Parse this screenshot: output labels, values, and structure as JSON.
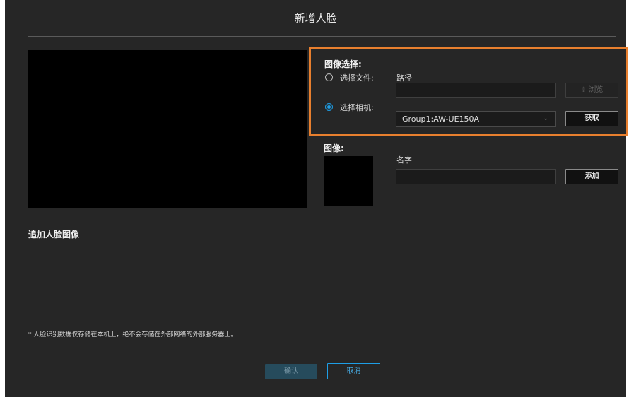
{
  "dialog": {
    "title": "新增人脸",
    "image_select": {
      "heading": "图像选择:",
      "option_file": "选择文件:",
      "option_camera": "选择相机:",
      "path_label": "路径",
      "path_value": "",
      "browse_label": "浏览",
      "camera_value": "Group1:AW-UE150A",
      "acquire_label": "获取"
    },
    "image_label": "图像:",
    "name_label": "名字",
    "name_value": "",
    "add_label": "添加",
    "append_heading": "追加人脸图像",
    "note": "* 人脸识别数据仅存储在本机上，绝不会存储在外部网络的外部服务器上。",
    "confirm_label": "确认",
    "cancel_label": "取消"
  },
  "colors": {
    "accent": "#1e9ee6",
    "highlight": "#e87f2e",
    "background": "#262626"
  }
}
